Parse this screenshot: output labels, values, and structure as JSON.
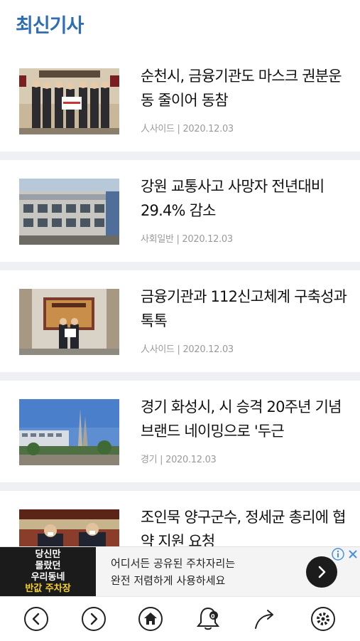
{
  "section": {
    "title": "최신기사"
  },
  "articles": [
    {
      "headline": "순천시, 금융기관도 마스크 권분운동 줄이어 동참",
      "category": "人사이드",
      "date": "2020.12.03",
      "thumb": "ceremony-group-photo"
    },
    {
      "headline": "강원 교통사고 사망자 전년대비 29.4% 감소",
      "category": "사회일반",
      "date": "2020.12.03",
      "thumb": "police-building"
    },
    {
      "headline": "금융기관과 112신고체계 구축성과 톡톡",
      "category": "人사이드",
      "date": "2020.12.03",
      "thumb": "plaque-presentation"
    },
    {
      "headline": "경기 화성시, 시 승격 20주년 기념 브랜드 네이밍으로 '두근",
      "category": "경기",
      "date": "2020.12.03",
      "thumb": "city-hall-tower"
    },
    {
      "headline": "조인묵 양구군수, 정세균 총리에 협약 지원 요청",
      "category": "",
      "date": "",
      "thumb": "officials-meeting"
    }
  ],
  "ad": {
    "image_lines": [
      "당신만",
      "몰랐던",
      "우리동네",
      "반값 주차장"
    ],
    "text_line1": "어디서든 공유된 주차자리는",
    "text_line2": "완전 저렴하게 사용하세요",
    "info_icon": "info-icon",
    "close_icon": "close-icon",
    "cta_icon": "chevron-right-icon"
  },
  "bottom_nav": {
    "items": [
      "back-icon",
      "forward-icon",
      "home-icon",
      "bell-icon",
      "share-icon",
      "settings-icon"
    ],
    "notification_count": "0"
  },
  "colors": {
    "accent": "#2f6db5",
    "text": "#111111",
    "meta": "#9a9a9a",
    "separator": "#eef0f3"
  }
}
